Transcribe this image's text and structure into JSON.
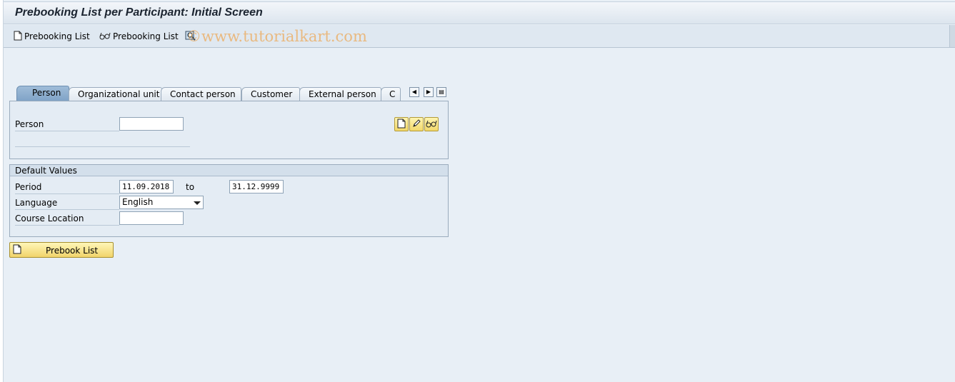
{
  "window": {
    "title": "Prebooking List per Participant: Initial Screen"
  },
  "toolbar": {
    "items": [
      {
        "label": "Prebooking List",
        "icon": "create-document-icon"
      },
      {
        "label": "Prebooking List",
        "icon": "display-glasses-icon"
      }
    ],
    "extra_icon": "search-icon",
    "watermark": "©www.tutorialkart.com"
  },
  "tabs": {
    "items": [
      {
        "label": "Person",
        "active": true
      },
      {
        "label": "Organizational unit",
        "active": false
      },
      {
        "label": "Contact person",
        "active": false
      },
      {
        "label": "Customer",
        "active": false
      },
      {
        "label": "External person",
        "active": false
      },
      {
        "label": "C",
        "active": false
      }
    ]
  },
  "person_panel": {
    "person_label": "Person",
    "person_value": ""
  },
  "defaults": {
    "header": "Default Values",
    "period_label": "Period",
    "period_from": "11.09.2018",
    "period_to_label": "to",
    "period_to": "31.12.9999",
    "language_label": "Language",
    "language_value": "English",
    "location_label": "Course Location",
    "location_value": ""
  },
  "action": {
    "prebook_label": "Prebook List"
  },
  "colors": {
    "accent": "#7fa2c6",
    "button": "#f1d46a",
    "background": "#e8eff6"
  }
}
